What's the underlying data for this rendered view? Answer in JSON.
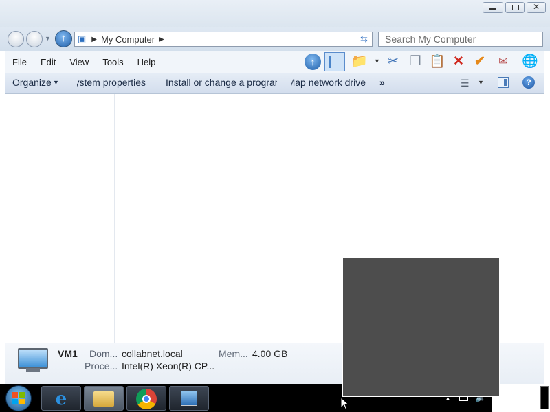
{
  "address": {
    "path": "My Computer"
  },
  "search": {
    "placeholder": "Search My Computer"
  },
  "menu": {
    "items": [
      "File",
      "Edit",
      "View",
      "Tools",
      "Help"
    ]
  },
  "command_bar": {
    "organize": "Organize",
    "system_properties": "System properties",
    "install_program": "Install or change a program",
    "map_drive": "Map network drive",
    "more": "»"
  },
  "details": {
    "computer_name": "VM1",
    "domain_label": "Dom...",
    "domain_value": "collabnet.local",
    "memory_label": "Mem...",
    "memory_value": "4.00 GB",
    "processor_label": "Proce...",
    "processor_value": "Intel(R) Xeon(R) CP..."
  },
  "colors": {
    "taskbar": "#000000",
    "overlay": "#4d4d4d",
    "accent": "#1f6fc5"
  }
}
